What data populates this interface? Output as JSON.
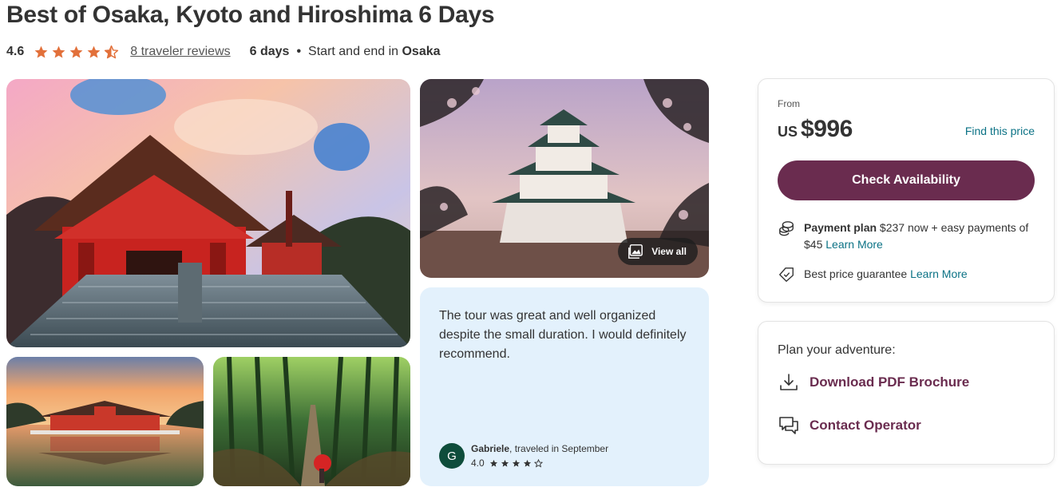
{
  "title": "Best of Osaka, Kyoto and Hiroshima 6 Days",
  "meta": {
    "rating": "4.6",
    "stars": 4.5,
    "reviews": "8 traveler reviews",
    "duration": "6 days",
    "separator": "•",
    "start_end_prefix": "Start and end in",
    "start_end_city": "Osaka"
  },
  "gallery": {
    "view_all_label": "View all",
    "icons": [
      "gallery-icon"
    ]
  },
  "review": {
    "text": "The tour was great and well organized despite the small duration. I would definitely recommend.",
    "avatar_initial": "G",
    "name": "Gabriele",
    "travel_note": ", traveled in September",
    "rating": "4.0",
    "stars": 4
  },
  "pricing": {
    "from": "From",
    "currency": "US",
    "amount": "$996",
    "find_price": "Find this price",
    "check_button": "Check Availability",
    "payment_label": "Payment plan",
    "payment_text": " $237 now + easy payments of $45 ",
    "payment_link": "Learn More",
    "guarantee_text": "Best price guarantee ",
    "guarantee_link": "Learn More"
  },
  "plan": {
    "title": "Plan your adventure:",
    "download": "Download PDF Brochure",
    "contact": "Contact Operator"
  },
  "colors": {
    "star": "#e2703a",
    "brand": "#6a2c4f",
    "link": "#0b7285",
    "review_bg": "#e3f1fc",
    "avatar": "#0e4d3b"
  }
}
